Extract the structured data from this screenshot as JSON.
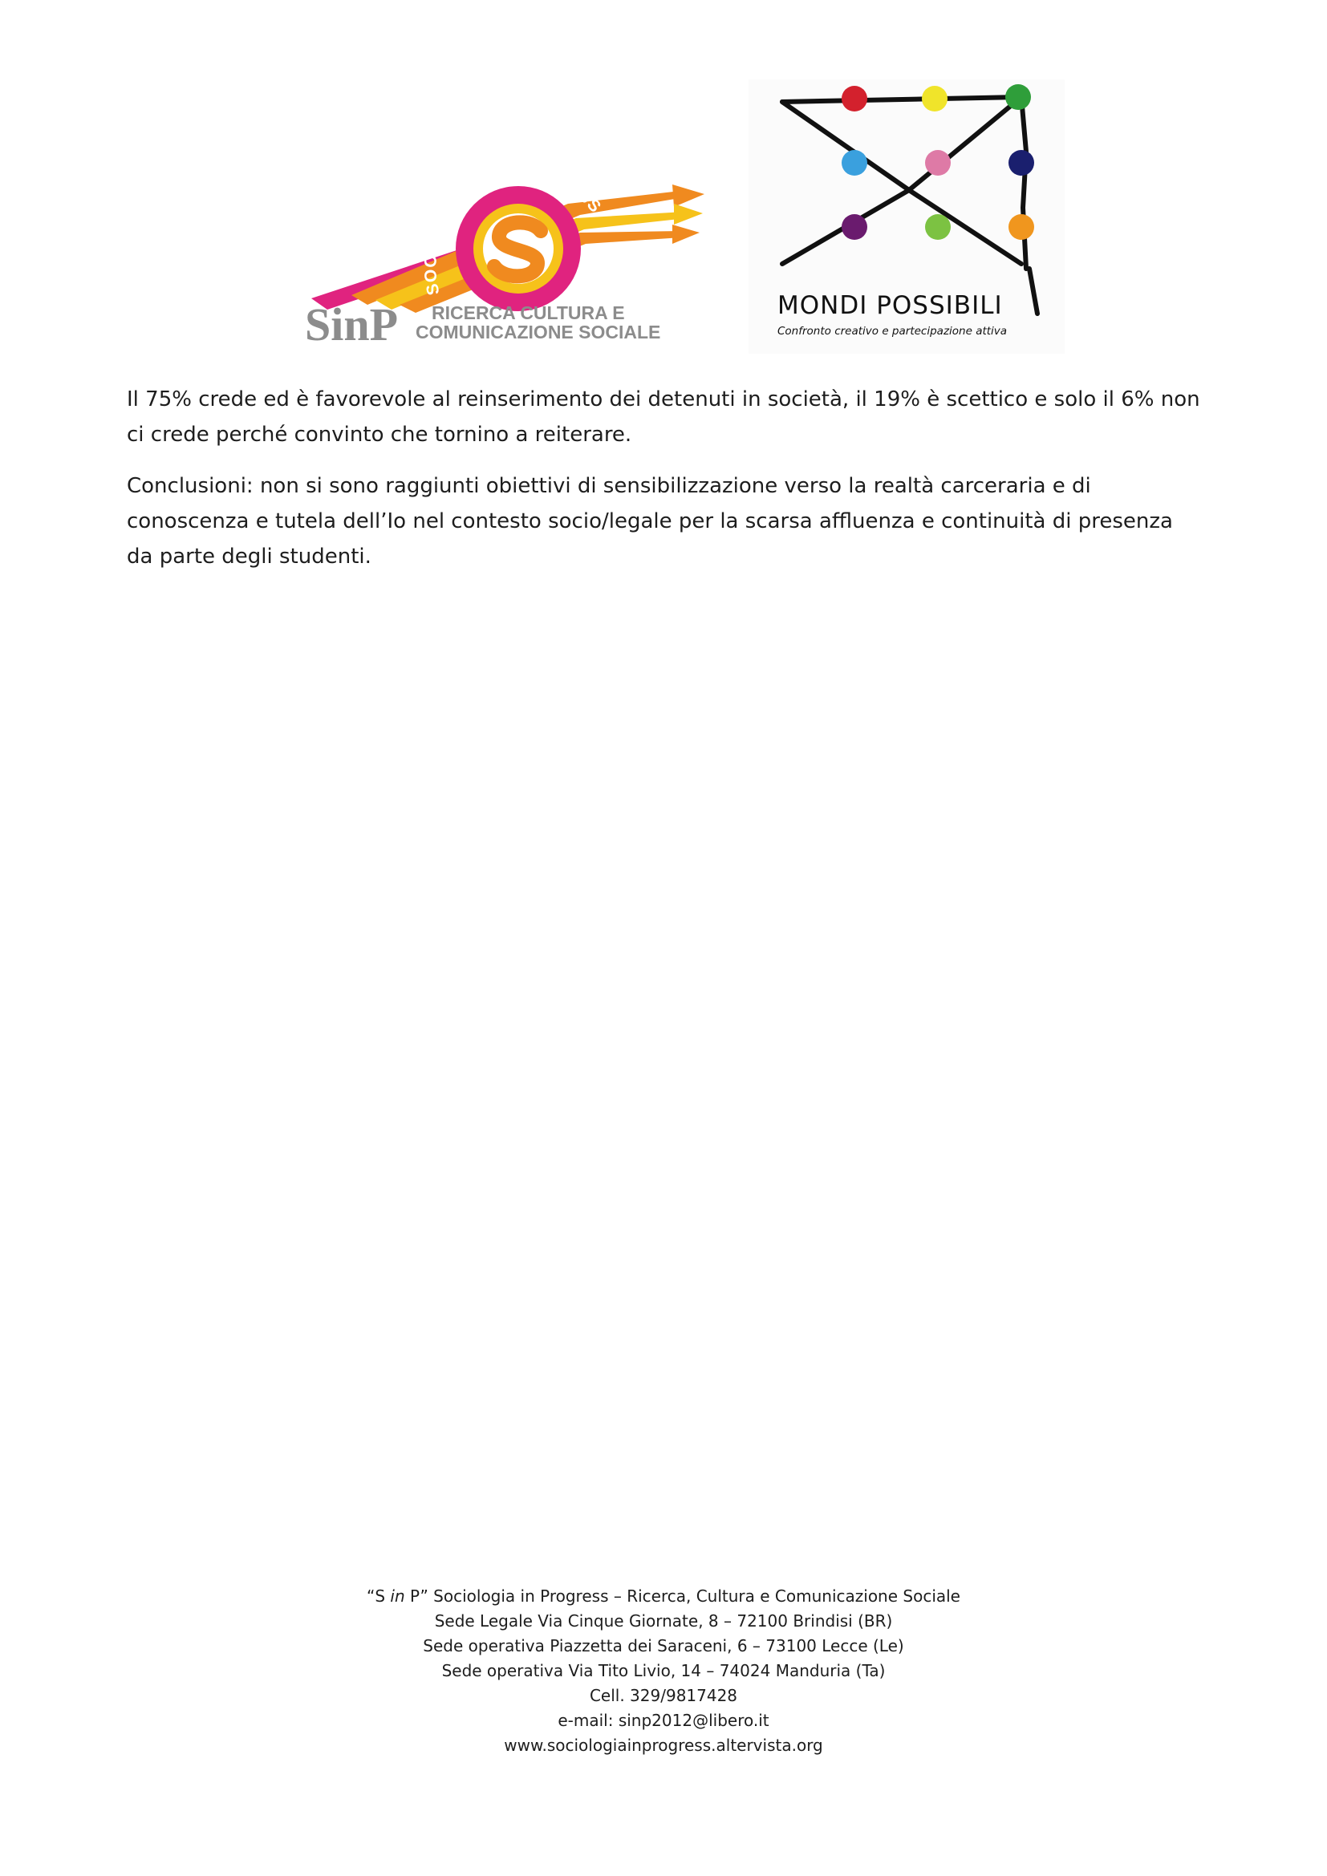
{
  "header": {
    "logo_left": {
      "arc_text": "SOCIOLOGIA in PROGRESS",
      "monogram": "SinP",
      "tagline_line1": "RICERCA CULTURA E",
      "tagline_line2": "COMUNICAZIONE SOCIALE",
      "colors": {
        "magenta": "#e0237f",
        "orange": "#f08a1f",
        "yellow": "#f6c21a",
        "gray": "#8c8c8c"
      }
    },
    "logo_right": {
      "title": "MONDI POSSIBILI",
      "subtitle": "Confronto creativo e partecipazione attiva",
      "dot_colors": [
        "#d3212d",
        "#f0e42a",
        "#2f9e3a",
        "#3aa0de",
        "#de7aa6",
        "#1a1f6e",
        "#6a1b6e",
        "#7cc242",
        "#f0961e"
      ]
    }
  },
  "body": {
    "paragraph1": "Il 75% crede ed è favorevole al reinserimento dei detenuti in società, il 19% è scettico e solo il 6% non ci crede perché convinto che tornino a reiterare.",
    "paragraph2": "Conclusioni: non si sono raggiunti obiettivi di sensibilizzazione verso la realtà carceraria e di conoscenza e tutela dell’Io nel contesto socio/legale per la scarsa affluenza e continuità di presenza da parte degli studenti."
  },
  "footer": {
    "line1_prefix": "“S ",
    "line1_italic": "in",
    "line1_suffix": " P” Sociologia in Progress – Ricerca, Cultura e Comunicazione Sociale",
    "line2": "Sede Legale Via Cinque Giornate, 8 – 72100 Brindisi (BR)",
    "line3": "Sede operativa Piazzetta dei Saraceni, 6 – 73100 Lecce (Le)",
    "line4": "Sede operativa Via Tito Livio, 14 – 74024 Manduria (Ta)",
    "line5": "Cell. 329/9817428",
    "line6": "e-mail: sinp2012@libero.it",
    "line7": "www.sociologiainprogress.altervista.org"
  }
}
